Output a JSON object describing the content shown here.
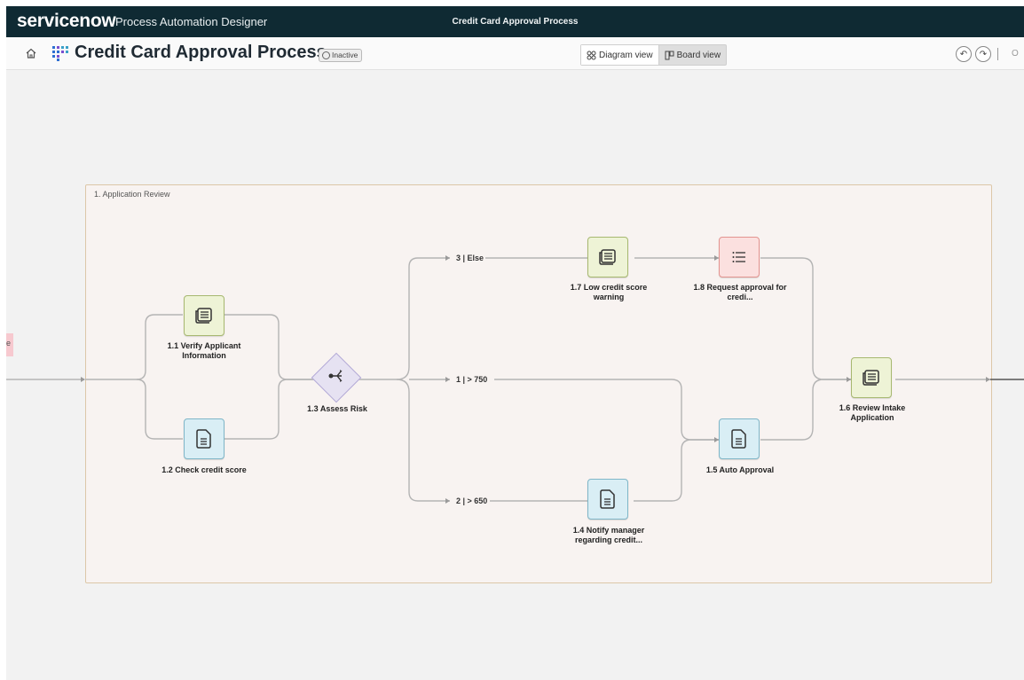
{
  "topbar": {
    "logo": "servicenow",
    "app_name": "Process Automation Designer",
    "center_title": "Credit Card Approval Process"
  },
  "header": {
    "title": "Credit Card Approval Process",
    "status": "Inactive",
    "views": [
      "Diagram view",
      "Board view"
    ],
    "cut_text": "O"
  },
  "canvas": {
    "left_tab_char": "e",
    "stage_label": "1. Application Review",
    "nodes": {
      "verify": "1.1 Verify Applicant Information",
      "credit": "1.2 Check credit score",
      "assess": "1.3 Assess Risk",
      "notify": "1.4 Notify manager regarding credit...",
      "auto": "1.5 Auto Approval",
      "review": "1.6 Review Intake Application",
      "low": "1.7 Low credit score warning",
      "request": "1.8 Request approval for credi..."
    },
    "branches": {
      "else": "3 | Else",
      "gt750": "1 | > 750",
      "gt650": "2 | > 650"
    }
  },
  "colors": {
    "topbar": "#0f2a33",
    "stage_border": "#dcc7a8",
    "activity_green": "#eef3d6",
    "activity_blue": "#d9eef5",
    "activity_red": "#fbe0df",
    "decision": "#e6e2f2"
  }
}
